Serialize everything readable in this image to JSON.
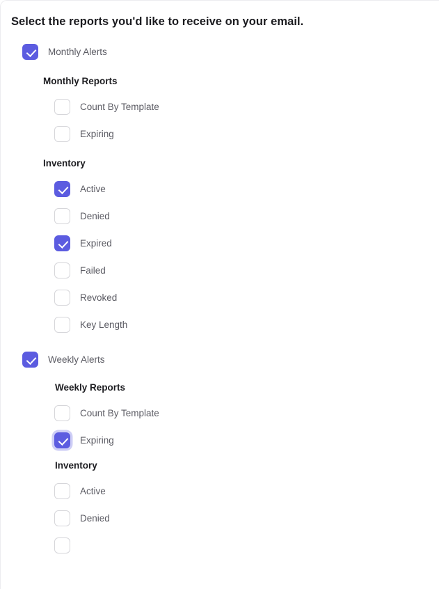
{
  "page": {
    "title": "Select the reports you'd like to receive on your email."
  },
  "sections": [
    {
      "id": "monthly-alerts",
      "label": "Monthly Alerts",
      "checked": true,
      "groups": [
        {
          "id": "monthly-reports",
          "heading": "Monthly Reports",
          "items": [
            {
              "id": "monthly-count-by-template",
              "label": "Count By Template",
              "checked": false
            },
            {
              "id": "monthly-expiring",
              "label": "Expiring",
              "checked": false
            }
          ]
        },
        {
          "id": "monthly-inventory",
          "heading": "Inventory",
          "items": [
            {
              "id": "monthly-active",
              "label": "Active",
              "checked": true
            },
            {
              "id": "monthly-denied",
              "label": "Denied",
              "checked": false
            },
            {
              "id": "monthly-expired",
              "label": "Expired",
              "checked": true
            },
            {
              "id": "monthly-failed",
              "label": "Failed",
              "checked": false
            },
            {
              "id": "monthly-revoked",
              "label": "Revoked",
              "checked": false
            },
            {
              "id": "monthly-key-length",
              "label": "Key Length",
              "checked": false
            }
          ]
        }
      ]
    },
    {
      "id": "weekly-alerts",
      "label": "Weekly Alerts",
      "checked": true,
      "groups": [
        {
          "id": "weekly-reports",
          "heading": "Weekly Reports",
          "items": [
            {
              "id": "weekly-count-by-template",
              "label": "Count By Template",
              "checked": false
            },
            {
              "id": "weekly-expiring",
              "label": "Expiring",
              "checked": true,
              "focused": true
            }
          ]
        },
        {
          "id": "weekly-inventory",
          "heading": "Inventory",
          "items": [
            {
              "id": "weekly-active",
              "label": "Active",
              "checked": false
            },
            {
              "id": "weekly-denied",
              "label": "Denied",
              "checked": false
            },
            {
              "id": "weekly-partial",
              "label": "",
              "checked": false
            }
          ]
        }
      ]
    }
  ],
  "colors": {
    "accent": "#5c5ce0",
    "focus_ring": "#7e7ee8",
    "heading_text": "#1d1d21",
    "label_text": "#5b5b63",
    "checkbox_border": "#d6d6da",
    "card_border": "#ececef"
  }
}
